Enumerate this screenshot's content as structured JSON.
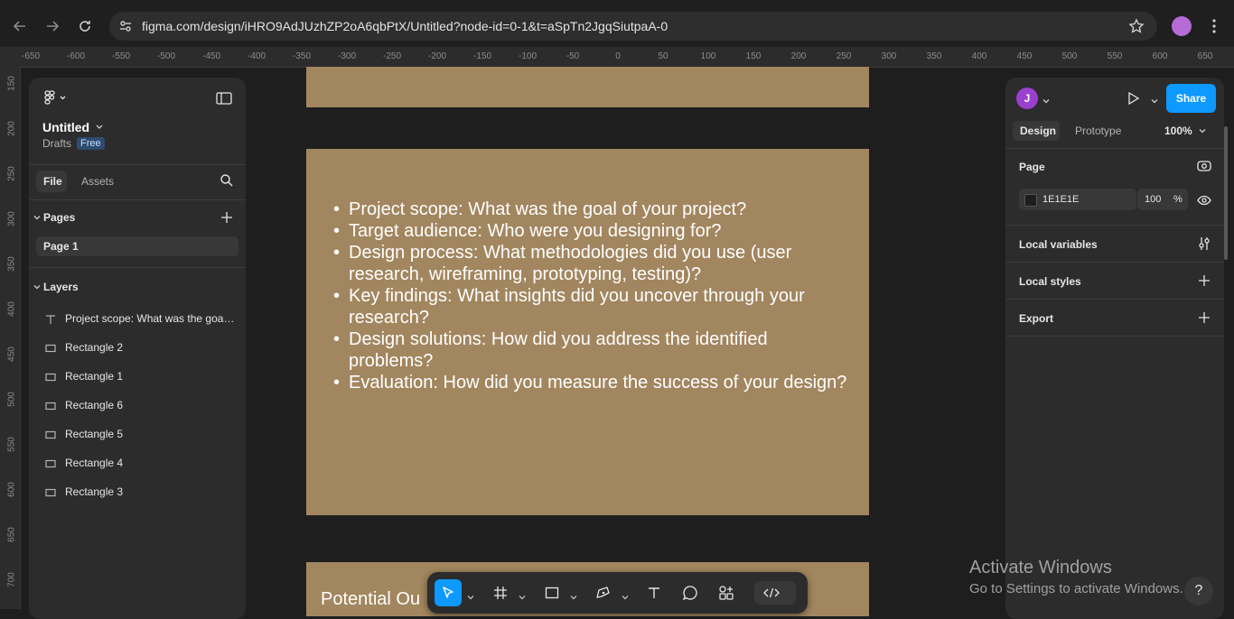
{
  "browser": {
    "url": "figma.com/design/iHRO9AdJUzhZP2oA6qbPtX/Untitled?node-id=0-1&t=aSpTn2JgqSiutpaA-0"
  },
  "rulers": {
    "horizontal": [
      "-650",
      "-600",
      "-550",
      "-500",
      "-450",
      "-400",
      "-350",
      "-300",
      "-250",
      "-200",
      "-150",
      "-100",
      "-50",
      "0",
      "50",
      "100",
      "150",
      "200",
      "250",
      "300",
      "350",
      "400",
      "450",
      "500",
      "550",
      "600",
      "650"
    ],
    "vertical": [
      "150",
      "200",
      "250",
      "300",
      "350",
      "400",
      "450",
      "500",
      "550",
      "600",
      "650",
      "700"
    ]
  },
  "file": {
    "name": "Untitled",
    "location": "Drafts",
    "plan_badge": "Free"
  },
  "left_tabs": {
    "file": "File",
    "assets": "Assets"
  },
  "pages": {
    "heading": "Pages",
    "items": [
      "Page 1"
    ]
  },
  "layers": {
    "heading": "Layers",
    "items": [
      {
        "label": "Project scope: What was the goal ...",
        "icon": "text-icon"
      },
      {
        "label": "Rectangle 2",
        "icon": "rectangle-icon"
      },
      {
        "label": "Rectangle 1",
        "icon": "rectangle-icon"
      },
      {
        "label": "Rectangle 6",
        "icon": "rectangle-icon"
      },
      {
        "label": "Rectangle 5",
        "icon": "rectangle-icon"
      },
      {
        "label": "Rectangle 4",
        "icon": "rectangle-icon"
      },
      {
        "label": "Rectangle 3",
        "icon": "rectangle-icon"
      }
    ]
  },
  "canvas": {
    "frame_color": "#a2865f",
    "bullets": [
      "Project scope: What was the goal of your project?",
      "Target audience: Who were you designing for?",
      "Design process: What methodologies did you use (user research, wireframing, prototyping, testing)?",
      "Key findings: What insights did you uncover through your research?",
      "Design solutions: How did you address the identified problems?",
      "Evaluation: How did you measure the success of your design?"
    ],
    "bottom_frame_text": "Potential Ou"
  },
  "right_panel": {
    "avatar_initial": "J",
    "avatar_color": "#9b3fcf",
    "share_label": "Share",
    "share_color": "#0d99ff",
    "tabs": {
      "design": "Design",
      "prototype": "Prototype"
    },
    "zoom": "100%",
    "page_section": "Page",
    "page_color_hex": "1E1E1E",
    "page_opacity": "100",
    "percent": "%",
    "local_variables": "Local variables",
    "local_styles": "Local styles",
    "export": "Export"
  },
  "watermark": {
    "title": "Activate Windows",
    "subtitle": "Go to Settings to activate Windows."
  },
  "help_label": "?"
}
